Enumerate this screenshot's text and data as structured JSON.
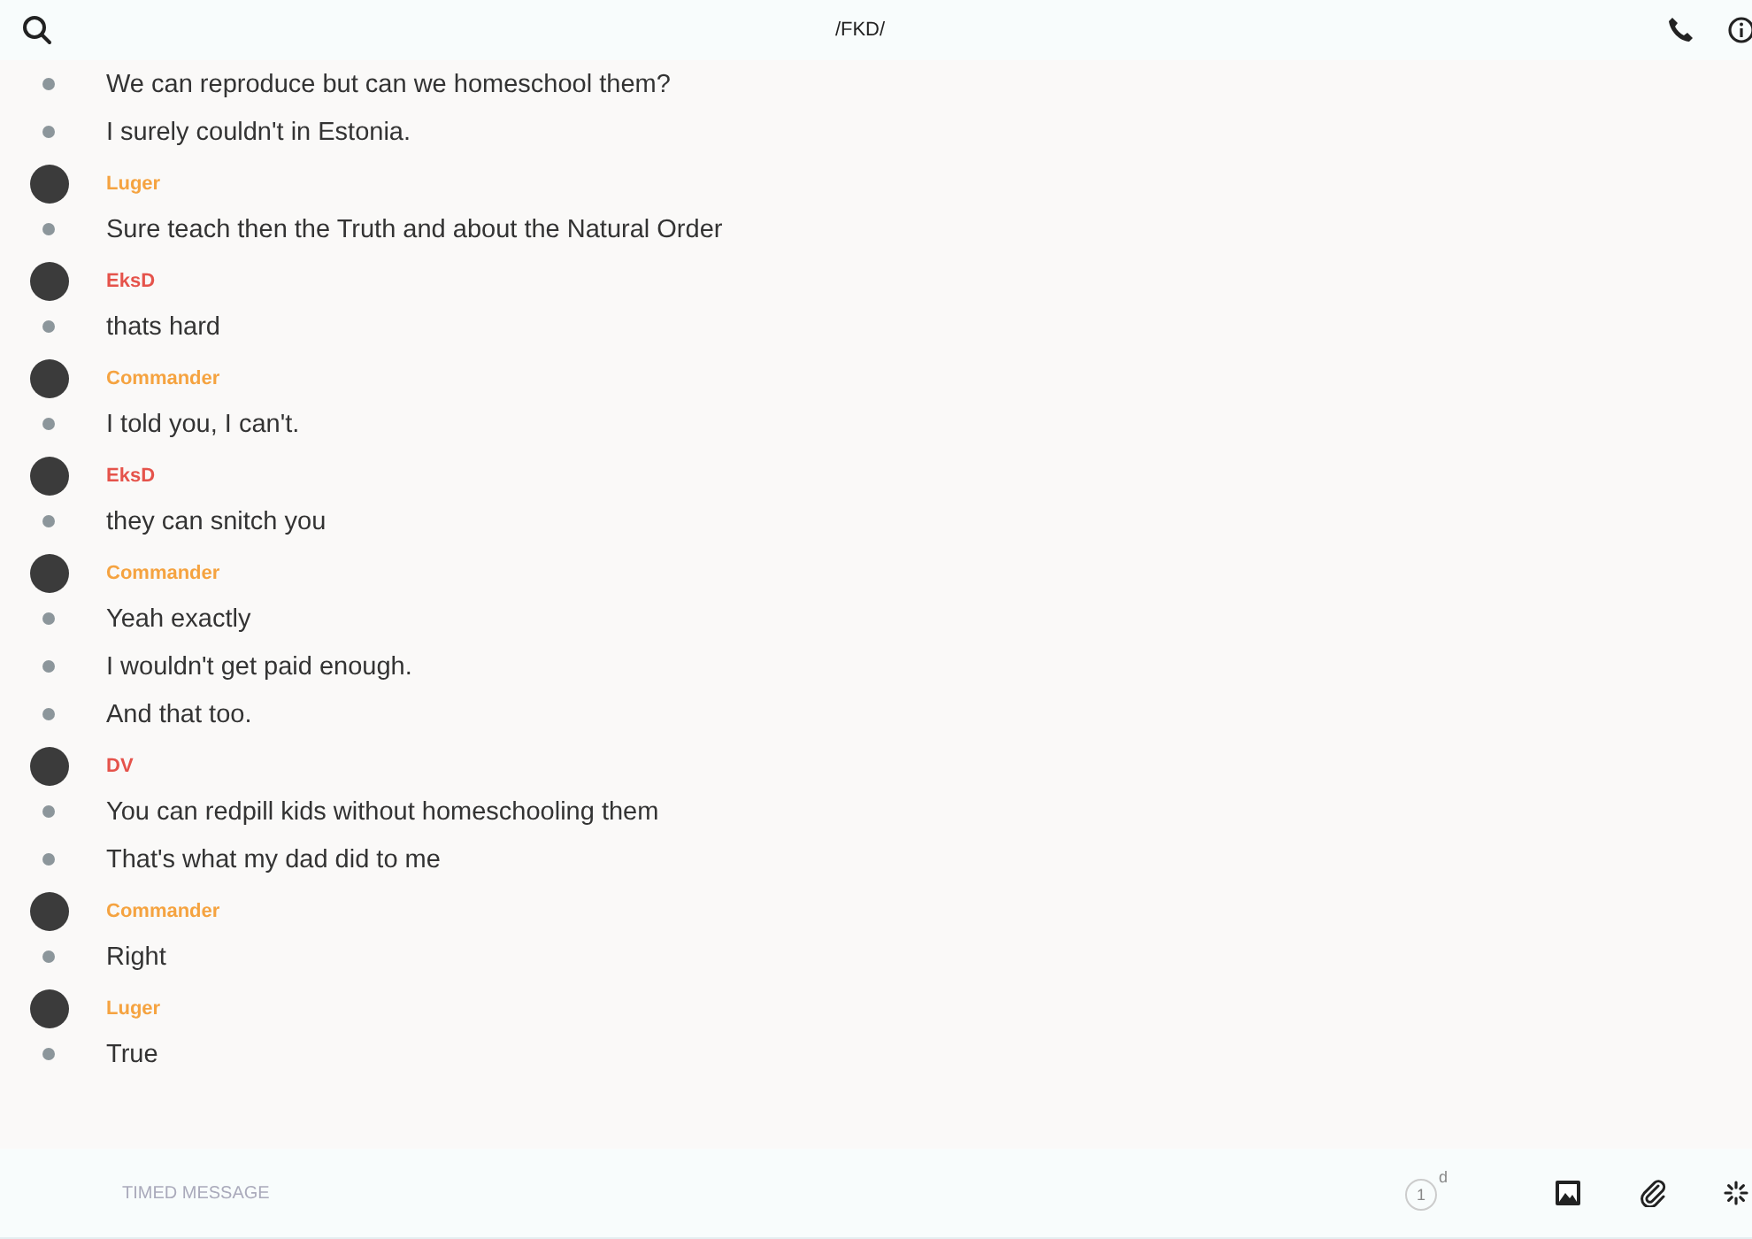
{
  "header": {
    "title": "/FKD/"
  },
  "groups": [
    {
      "messages": [
        "We can reproduce but can we homeschool them?",
        "I surely couldn't in Estonia."
      ]
    },
    {
      "author": {
        "name": "Luger",
        "color": "#f5a340"
      },
      "messages": [
        "Sure teach then the Truth and about the Natural Order"
      ]
    },
    {
      "author": {
        "name": "EksD",
        "color": "#e5534b"
      },
      "messages": [
        "thats hard"
      ]
    },
    {
      "author": {
        "name": "Commander",
        "color": "#f5a340"
      },
      "messages": [
        "I told you, I can't."
      ]
    },
    {
      "author": {
        "name": "EksD",
        "color": "#e5534b"
      },
      "messages": [
        "they can snitch you"
      ]
    },
    {
      "author": {
        "name": "Commander",
        "color": "#f5a340"
      },
      "messages": [
        "Yeah exactly",
        "I wouldn't get paid enough.",
        "And that too."
      ]
    },
    {
      "author": {
        "name": "DV",
        "color": "#e5534b"
      },
      "messages": [
        "You can redpill kids without homeschooling them",
        "That's what my dad did to me"
      ]
    },
    {
      "author": {
        "name": "Commander",
        "color": "#f5a340"
      },
      "messages": [
        "Right"
      ]
    },
    {
      "author": {
        "name": "Luger",
        "color": "#f5a340"
      },
      "messages": [
        "True"
      ]
    }
  ],
  "composer": {
    "placeholder": "TIMED MESSAGE",
    "timer_value": "1",
    "timer_unit": "d"
  }
}
